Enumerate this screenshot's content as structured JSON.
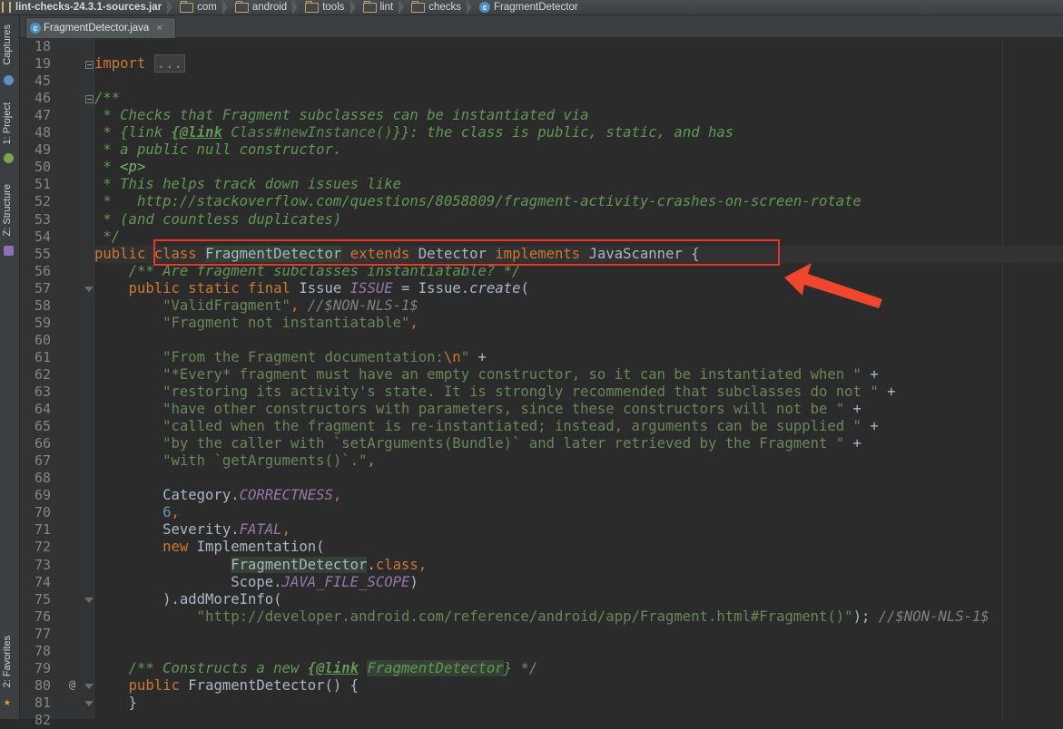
{
  "breadcrumb": [
    {
      "label": "lint-checks-24.3.1-sources.jar",
      "icon": "jar-icon"
    },
    {
      "label": "com",
      "icon": "folder-icon"
    },
    {
      "label": "android",
      "icon": "folder-icon"
    },
    {
      "label": "tools",
      "icon": "folder-icon"
    },
    {
      "label": "lint",
      "icon": "folder-icon"
    },
    {
      "label": "checks",
      "icon": "folder-icon"
    },
    {
      "label": "FragmentDetector",
      "icon": "class-icon"
    }
  ],
  "tab": {
    "label": "FragmentDetector.java",
    "icon": "class-icon",
    "close": "×"
  },
  "class_icon_letter": "c",
  "toolwindows": {
    "captures": "Captures",
    "project": "1: Project",
    "structure": "Z: Structure",
    "favorites": "2: Favorites"
  },
  "fold_placeholder": "...",
  "override_marker": "@",
  "code": [
    {
      "n": "18",
      "tokens": []
    },
    {
      "n": "19",
      "tokens": [
        {
          "t": "kw",
          "v": "import"
        },
        {
          "t": "p",
          "v": " "
        },
        {
          "t": "fold",
          "v": "..."
        }
      ]
    },
    {
      "n": "45",
      "tokens": []
    },
    {
      "n": "46",
      "tokens": [
        {
          "t": "cmt",
          "v": "/**"
        }
      ]
    },
    {
      "n": "47",
      "tokens": [
        {
          "t": "cmt",
          "v": " * Checks that Fragment subclasses can be instantiated via"
        }
      ]
    },
    {
      "n": "48",
      "tokens": [
        {
          "t": "cmt",
          "v": " * {link "
        },
        {
          "t": "doctag",
          "v": "{@link"
        },
        {
          "t": "cmt",
          "v": " "
        },
        {
          "t": "docref",
          "v": "Class#newInstance()"
        },
        {
          "t": "cmt",
          "v": "}}: the class is public, static, and has"
        }
      ]
    },
    {
      "n": "49",
      "tokens": [
        {
          "t": "cmt",
          "v": " * a public null constructor."
        }
      ]
    },
    {
      "n": "50",
      "tokens": [
        {
          "t": "cmt",
          "v": " * "
        },
        {
          "t": "docmarkup",
          "v": "<p>"
        }
      ]
    },
    {
      "n": "51",
      "tokens": [
        {
          "t": "cmt",
          "v": " * This helps track down issues like"
        }
      ]
    },
    {
      "n": "52",
      "tokens": [
        {
          "t": "cmt",
          "v": " *   http://stackoverflow.com/questions/8058809/fragment-activity-crashes-on-screen-rotate"
        }
      ]
    },
    {
      "n": "53",
      "tokens": [
        {
          "t": "cmt",
          "v": " * (and countless duplicates)"
        }
      ]
    },
    {
      "n": "54",
      "tokens": [
        {
          "t": "cmt",
          "v": " */"
        }
      ]
    },
    {
      "n": "55",
      "tokens": [
        {
          "t": "kw",
          "v": "public"
        },
        {
          "t": "p",
          "v": " "
        },
        {
          "t": "kw",
          "v": "class"
        },
        {
          "t": "p",
          "v": " "
        },
        {
          "t": "hl",
          "v": "FragmentDetector"
        },
        {
          "t": "p",
          "v": " "
        },
        {
          "t": "kw",
          "v": "extends"
        },
        {
          "t": "p",
          "v": " Detector "
        },
        {
          "t": "kw",
          "v": "implements"
        },
        {
          "t": "p",
          "v": " JavaScanner {"
        }
      ]
    },
    {
      "n": "56",
      "tokens": [
        {
          "t": "p",
          "v": "    "
        },
        {
          "t": "cmt",
          "v": "/** Are fragment subclasses instantiatable? */"
        }
      ]
    },
    {
      "n": "57",
      "tokens": [
        {
          "t": "p",
          "v": "    "
        },
        {
          "t": "kw",
          "v": "public static final"
        },
        {
          "t": "p",
          "v": " Issue "
        },
        {
          "t": "fld",
          "v": "ISSUE"
        },
        {
          "t": "p",
          "v": " = Issue."
        },
        {
          "t": "mth",
          "v": "create"
        },
        {
          "t": "p",
          "v": "("
        }
      ]
    },
    {
      "n": "58",
      "tokens": [
        {
          "t": "p",
          "v": "        "
        },
        {
          "t": "str",
          "v": "\"ValidFragment\""
        },
        {
          "t": "kw",
          "v": ","
        },
        {
          "t": "p",
          "v": " "
        },
        {
          "t": "lcmt",
          "v": "//$NON-NLS-1$"
        }
      ]
    },
    {
      "n": "59",
      "tokens": [
        {
          "t": "p",
          "v": "        "
        },
        {
          "t": "str",
          "v": "\"Fragment not instantiatable\""
        },
        {
          "t": "kw",
          "v": ","
        }
      ]
    },
    {
      "n": "60",
      "tokens": []
    },
    {
      "n": "61",
      "tokens": [
        {
          "t": "p",
          "v": "        "
        },
        {
          "t": "str",
          "v": "\"From the Fragment documentation:"
        },
        {
          "t": "esc",
          "v": "\\n"
        },
        {
          "t": "str",
          "v": "\""
        },
        {
          "t": "p",
          "v": " +"
        }
      ]
    },
    {
      "n": "62",
      "tokens": [
        {
          "t": "p",
          "v": "        "
        },
        {
          "t": "str",
          "v": "\"*Every* fragment must have an empty constructor, so it can be instantiated when \""
        },
        {
          "t": "p",
          "v": " +"
        }
      ]
    },
    {
      "n": "63",
      "tokens": [
        {
          "t": "p",
          "v": "        "
        },
        {
          "t": "str",
          "v": "\"restoring its activity's state. It is strongly recommended that subclasses do not \""
        },
        {
          "t": "p",
          "v": " +"
        }
      ]
    },
    {
      "n": "64",
      "tokens": [
        {
          "t": "p",
          "v": "        "
        },
        {
          "t": "str",
          "v": "\"have other constructors with parameters, since these constructors will not be \""
        },
        {
          "t": "p",
          "v": " +"
        }
      ]
    },
    {
      "n": "65",
      "tokens": [
        {
          "t": "p",
          "v": "        "
        },
        {
          "t": "str",
          "v": "\"called when the fragment is re-instantiated; instead, arguments can be supplied \""
        },
        {
          "t": "p",
          "v": " +"
        }
      ]
    },
    {
      "n": "66",
      "tokens": [
        {
          "t": "p",
          "v": "        "
        },
        {
          "t": "str",
          "v": "\"by the caller with `setArguments(Bundle)` and later retrieved by the Fragment \""
        },
        {
          "t": "p",
          "v": " +"
        }
      ]
    },
    {
      "n": "67",
      "tokens": [
        {
          "t": "p",
          "v": "        "
        },
        {
          "t": "str",
          "v": "\"with `getArguments()`.\""
        },
        {
          "t": "kw",
          "v": ","
        }
      ]
    },
    {
      "n": "68",
      "tokens": []
    },
    {
      "n": "69",
      "tokens": [
        {
          "t": "p",
          "v": "        Category."
        },
        {
          "t": "fld",
          "v": "CORRECTNESS"
        },
        {
          "t": "kw",
          "v": ","
        }
      ]
    },
    {
      "n": "70",
      "tokens": [
        {
          "t": "p",
          "v": "        "
        },
        {
          "t": "num",
          "v": "6"
        },
        {
          "t": "kw",
          "v": ","
        }
      ]
    },
    {
      "n": "71",
      "tokens": [
        {
          "t": "p",
          "v": "        Severity."
        },
        {
          "t": "fld",
          "v": "FATAL"
        },
        {
          "t": "kw",
          "v": ","
        }
      ]
    },
    {
      "n": "72",
      "tokens": [
        {
          "t": "p",
          "v": "        "
        },
        {
          "t": "kw",
          "v": "new"
        },
        {
          "t": "p",
          "v": " Implementation("
        }
      ]
    },
    {
      "n": "73",
      "tokens": [
        {
          "t": "p",
          "v": "                "
        },
        {
          "t": "hl",
          "v": "FragmentDetector"
        },
        {
          "t": "p",
          "v": "."
        },
        {
          "t": "kw",
          "v": "class,"
        }
      ]
    },
    {
      "n": "74",
      "tokens": [
        {
          "t": "p",
          "v": "                Scope."
        },
        {
          "t": "fld",
          "v": "JAVA_FILE_SCOPE"
        },
        {
          "t": "p",
          "v": ")"
        }
      ]
    },
    {
      "n": "75",
      "tokens": [
        {
          "t": "p",
          "v": "        ).addMoreInfo("
        }
      ]
    },
    {
      "n": "76",
      "tokens": [
        {
          "t": "p",
          "v": "            "
        },
        {
          "t": "str",
          "v": "\"http://developer.android.com/reference/android/app/Fragment.html#Fragment()\""
        },
        {
          "t": "p",
          "v": "); "
        },
        {
          "t": "lcmt",
          "v": "//$NON-NLS-1$"
        }
      ]
    },
    {
      "n": "77",
      "tokens": []
    },
    {
      "n": "78",
      "tokens": []
    },
    {
      "n": "79",
      "tokens": [
        {
          "t": "p",
          "v": "    "
        },
        {
          "t": "cmt",
          "v": "/** Constructs a new "
        },
        {
          "t": "doctag",
          "v": "{@link"
        },
        {
          "t": "cmt",
          "v": " "
        },
        {
          "t": "hl-cmt",
          "v": "FragmentDetector"
        },
        {
          "t": "cmt",
          "v": "} */"
        }
      ]
    },
    {
      "n": "80",
      "tokens": [
        {
          "t": "p",
          "v": "    "
        },
        {
          "t": "kw",
          "v": "public"
        },
        {
          "t": "p",
          "v": " FragmentDetector() {"
        }
      ]
    },
    {
      "n": "81",
      "tokens": [
        {
          "t": "p",
          "v": "    }"
        }
      ]
    },
    {
      "n": "82",
      "tokens": []
    }
  ],
  "colors": {
    "highlight_box": "#e8382a",
    "arrow": "#f0462e",
    "keyword": "#cc7832",
    "comment": "#629755",
    "string": "#6a8759",
    "number": "#6897bb",
    "field": "#9876aa"
  }
}
